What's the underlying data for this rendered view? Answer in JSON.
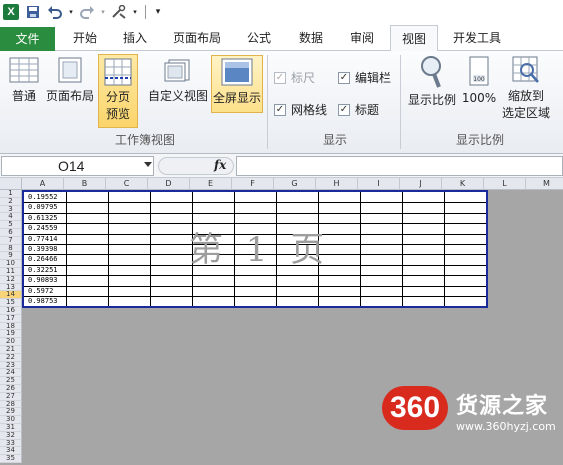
{
  "quick_access": {
    "app_logo": "X",
    "icons": [
      "save-icon",
      "undo-icon",
      "redo-icon",
      "customize-icon"
    ]
  },
  "tabs": [
    "文件",
    "开始",
    "插入",
    "页面布局",
    "公式",
    "数据",
    "审阅",
    "视图",
    "开发工具"
  ],
  "ribbon": {
    "workbook_views": {
      "normal": "普通",
      "page_layout": "页面布局",
      "page_break_preview": [
        "分页",
        "预览"
      ],
      "custom_views": "自定义视图",
      "full_screen": "全屏显示",
      "group_label": "工作簿视图"
    },
    "show": {
      "ruler": "标尺",
      "formula_bar": "编辑栏",
      "gridlines": "网格线",
      "headings": "标题",
      "group_label": "显示"
    },
    "zoom": {
      "zoom": "显示比例",
      "hundred": "100%",
      "zoom_selection": [
        "缩放到",
        "选定区域"
      ],
      "group_label": "显示比例"
    }
  },
  "formula_bar": {
    "name_box": "O14",
    "fx": "fx",
    "value": ""
  },
  "sheet": {
    "columns": [
      "A",
      "B",
      "C",
      "D",
      "E",
      "F",
      "G",
      "H",
      "I",
      "J",
      "K",
      "L",
      "M"
    ],
    "rows": [
      "1",
      "2",
      "3",
      "4",
      "5",
      "6",
      "7",
      "8",
      "9",
      "10",
      "11",
      "12",
      "13",
      "14",
      "15",
      "16",
      "17",
      "18",
      "19",
      "20",
      "21",
      "22",
      "23",
      "24",
      "25",
      "26",
      "27",
      "28",
      "29",
      "30",
      "31",
      "32",
      "33",
      "34",
      "35"
    ],
    "active_row": "14",
    "column_a_values": [
      "0.19552",
      "0.09795",
      "0.61325",
      "0.24559",
      "0.77414",
      "0.39398",
      "0.26466",
      "0.32251",
      "0.90893",
      "0.5972",
      "0.98753"
    ],
    "page_watermark": "第 1 页"
  },
  "logo": {
    "number": "360",
    "brand": "货源之家",
    "url": "www.360hyzj.com"
  }
}
